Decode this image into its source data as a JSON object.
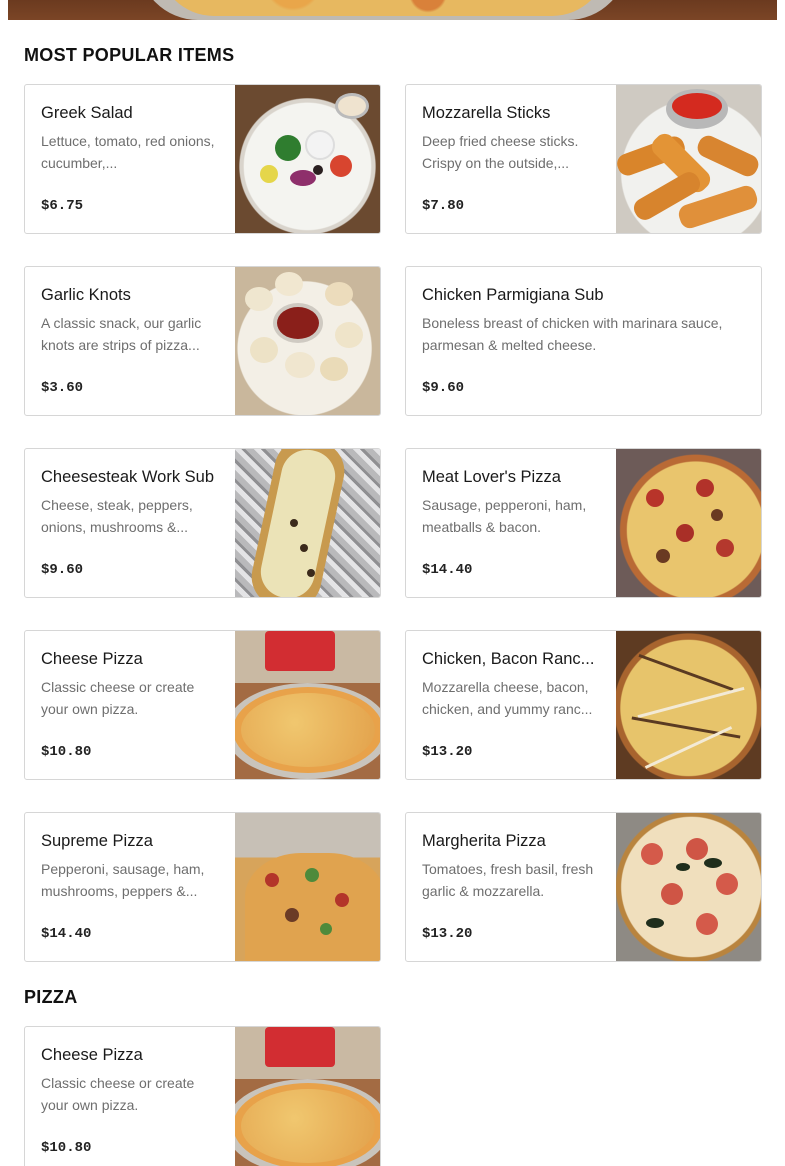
{
  "sections": [
    {
      "title": "MOST POPULAR ITEMS",
      "items": [
        {
          "name": "Greek Salad",
          "description": "Lettuce, tomato, red onions, cucumber,...",
          "price": "$6.75",
          "image": "greek-salad-photo"
        },
        {
          "name": "Mozzarella Sticks",
          "description": "Deep fried cheese sticks. Crispy on the outside,...",
          "price": "$7.80",
          "image": "mozzarella-sticks-photo"
        },
        {
          "name": "Garlic Knots",
          "description": "A classic snack, our garlic knots are strips of pizza...",
          "price": "$3.60",
          "image": "garlic-knots-photo"
        },
        {
          "name": "Chicken Parmigiana Sub",
          "description": "Boneless breast of chicken with marinara sauce, parmesan & melted cheese.",
          "price": "$9.60",
          "image": ""
        },
        {
          "name": "Cheesesteak Work Sub",
          "description": "Cheese, steak, peppers, onions, mushrooms &...",
          "price": "$9.60",
          "image": "cheesesteak-photo"
        },
        {
          "name": "Meat Lover's Pizza",
          "description": "Sausage, pepperoni, ham, meatballs & bacon.",
          "price": "$14.40",
          "image": "meat-lovers-pizza-photo"
        },
        {
          "name": "Cheese Pizza",
          "description": "Classic cheese or create your own pizza.",
          "price": "$10.80",
          "image": "cheese-pizza-photo"
        },
        {
          "name": "Chicken, Bacon Ranc...",
          "description": "Mozzarella cheese, bacon, chicken, and yummy ranc...",
          "price": "$13.20",
          "image": "chicken-bacon-ranch-pizza-photo"
        },
        {
          "name": "Supreme Pizza",
          "description": "Pepperoni, sausage, ham, mushrooms, peppers &...",
          "price": "$14.40",
          "image": "supreme-pizza-photo"
        },
        {
          "name": "Margherita Pizza",
          "description": "Tomatoes, fresh basil, fresh garlic & mozzarella.",
          "price": "$13.20",
          "image": "margherita-pizza-photo"
        }
      ]
    },
    {
      "title": "PIZZA",
      "items": [
        {
          "name": "Cheese Pizza",
          "description": "Classic cheese or create your own pizza.",
          "price": "$10.80",
          "image": "cheese-pizza-photo"
        }
      ]
    }
  ]
}
